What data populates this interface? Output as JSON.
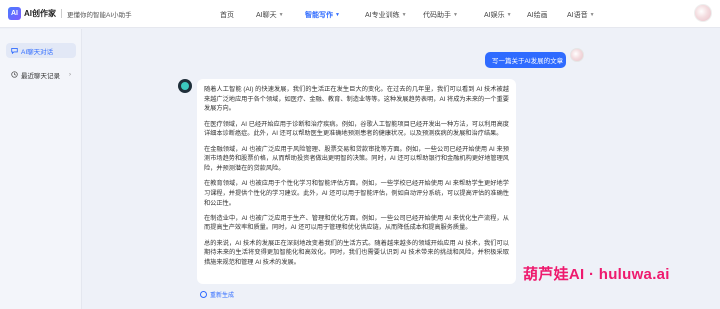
{
  "header": {
    "logo_mark": "AI",
    "app_name": "AI创作家",
    "slogan": "更懂你的智能AI小助手",
    "nav": [
      {
        "label": "首页",
        "has_caret": false,
        "active": false
      },
      {
        "label": "AI聊天",
        "has_caret": true,
        "active": false
      },
      {
        "label": "智能写作",
        "has_caret": true,
        "active": true
      },
      {
        "label": "AI专业训练",
        "has_caret": true,
        "active": false
      },
      {
        "label": "代码助手",
        "has_caret": true,
        "active": false
      },
      {
        "label": "AI娱乐",
        "has_caret": true,
        "active": false
      },
      {
        "label": "AI绘画",
        "has_caret": false,
        "active": false
      },
      {
        "label": "AI语音",
        "has_caret": true,
        "active": false
      }
    ]
  },
  "sidebar": {
    "items": [
      {
        "label": "AI聊天对话",
        "icon": "chat-icon",
        "active": true
      },
      {
        "label": "最近聊天记录",
        "icon": "clock-icon",
        "active": false
      }
    ]
  },
  "conversation": {
    "user_message": "写一篇关于AI发展的文章",
    "answer_paragraphs": [
      "随着人工智能 (AI) 的快速发展，我们的生活正在发生巨大的变化。在过去的几年里，我们可以看到 AI 技术被越来越广泛地应用于各个领域，如医疗、金融、教育、制造业等等。这种发展趋势表明，AI 将成为未来的一个重要发展方向。",
      "在医疗领域，AI 已经开始应用于诊断和治疗疾病。例如，谷歌人工智能项目已经开发出一种方法，可以利用高度详细本诊断癌症。此外，AI 还可以帮助医生更准确地预测患者的健康状况，以及预测疾病的发展和治疗结果。",
      "在金融领域，AI 也被广泛应用于风险管理、股票交易和贷款审批等方面。例如，一些公司已经开始使用 AI 来预测市场趋势和股票价格，从而帮助投资者做出更明智的决策。同时，AI 还可以帮助银行和金融机构更好地管理风险，并预测潜在的贷款风险。",
      "在教育领域，AI 也被应用于个性化学习和智能评估方面。例如，一些学校已经开始使用 AI 来帮助学生更好地学习课程，并提供个性化的学习建议。此外，AI 还可以用于智能评估，例如自动评分系统，可以提高评估的准确性和公正性。",
      "在制造业中，AI 也被广泛应用于生产、管理和优化方面。例如，一些公司已经开始使用 AI 来优化生产流程，从而提高生产效率和质量。同时，AI 还可以用于管理和优化供应链，从而降低成本和提高服务质量。",
      "总的来说，AI 技术的发展正在深刻地改变着我们的生活方式。随着越来越多的领域开始应用 AI 技术，我们可以期待未来的生活将变得更加智能化和高效化。同时，我们也需要认识到 AI 技术带来的挑战和风险，并积极采取措施来规范和管理 AI 技术的发展。"
    ],
    "regenerate_label": "重新生成"
  },
  "watermark": "葫芦娃AI · huluwa.ai",
  "colors": {
    "accent": "#2f6bff",
    "watermark": "#ee1a6e",
    "background": "#eef1f8"
  }
}
